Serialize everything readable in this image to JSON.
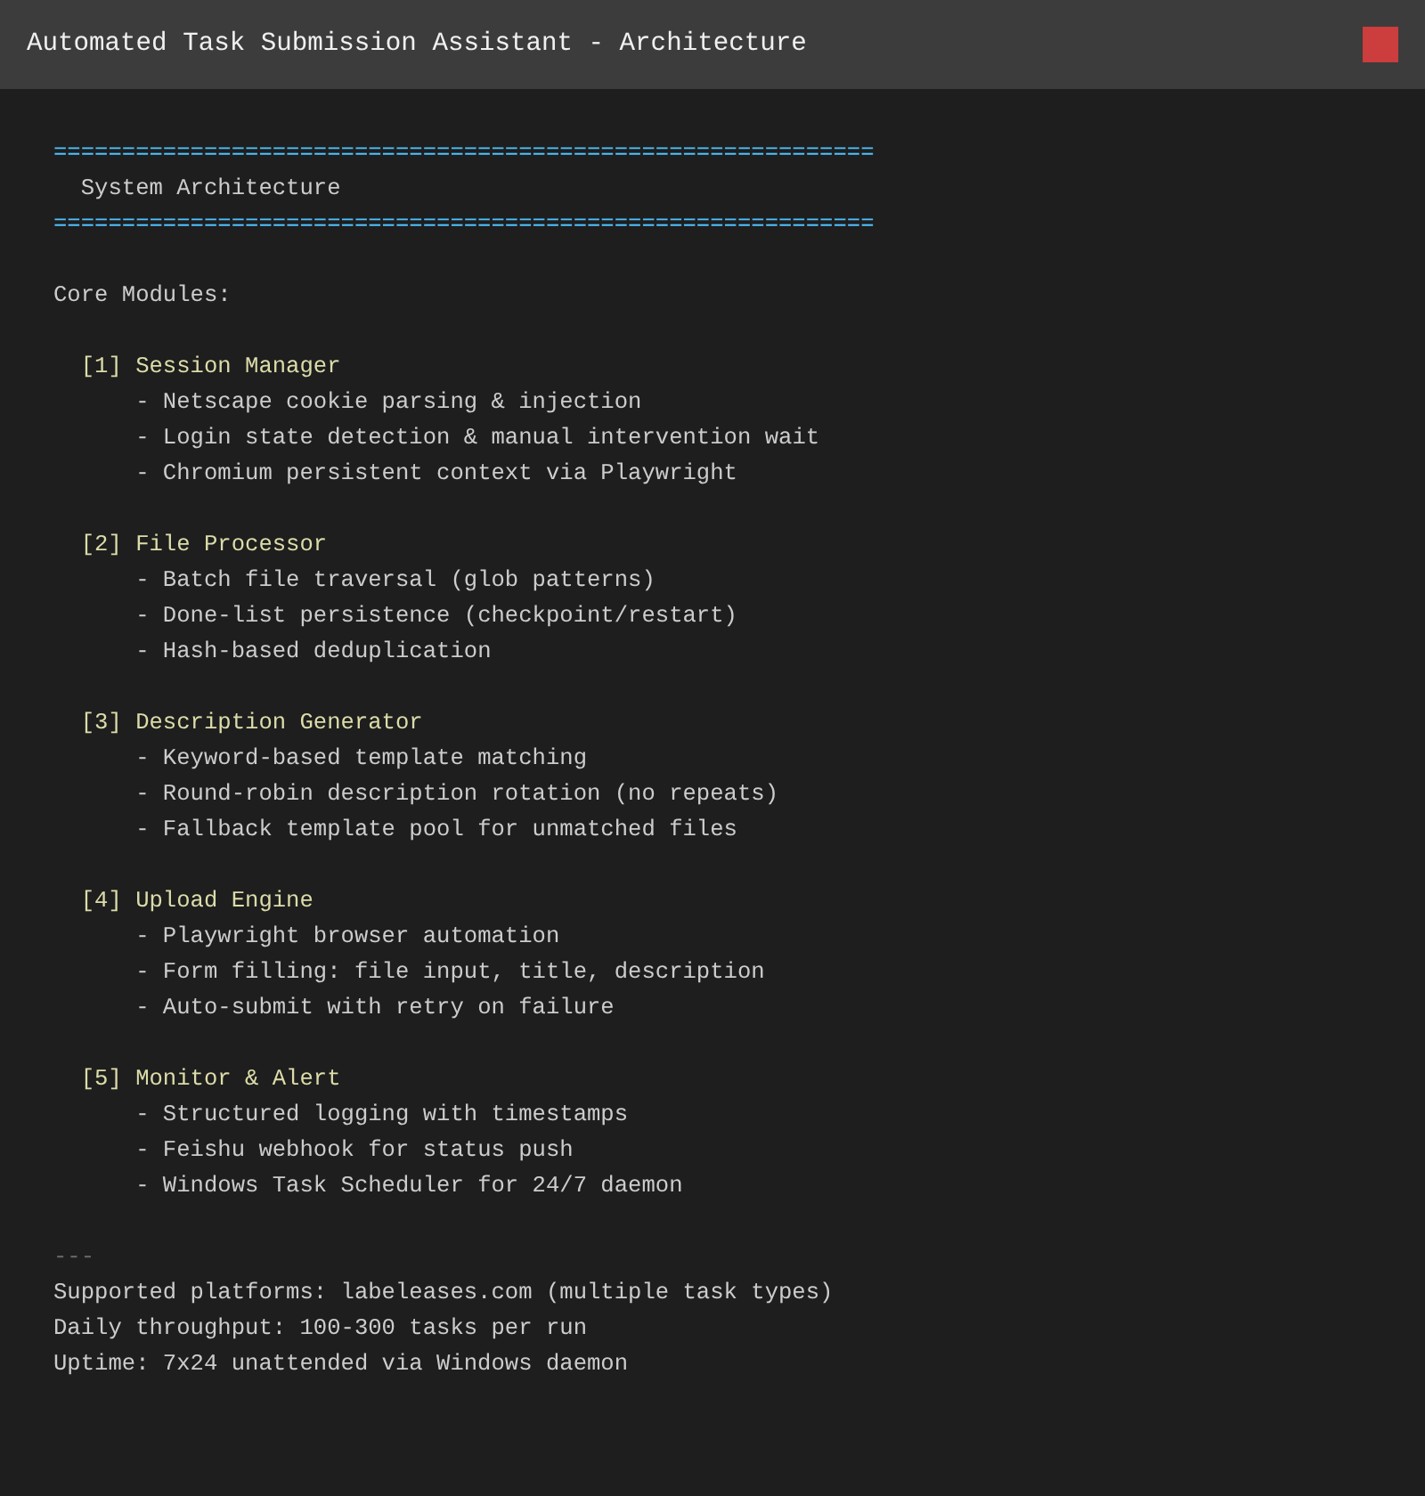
{
  "window": {
    "title": "Automated Task Submission Assistant - Architecture"
  },
  "banner": {
    "rule_top": "============================================================",
    "title": "System Architecture",
    "rule_bottom": "============================================================"
  },
  "heading": "Core Modules:",
  "modules": [
    {
      "number": "[1]",
      "name": "Session Manager",
      "items": [
        "- Netscape cookie parsing & injection",
        "- Login state detection & manual intervention wait",
        "- Chromium persistent context via Playwright"
      ]
    },
    {
      "number": "[2]",
      "name": "File Processor",
      "items": [
        "- Batch file traversal (glob patterns)",
        "- Done-list persistence (checkpoint/restart)",
        "- Hash-based deduplication"
      ]
    },
    {
      "number": "[3]",
      "name": "Description Generator",
      "items": [
        "- Keyword-based template matching",
        "- Round-robin description rotation (no repeats)",
        "- Fallback template pool for unmatched files"
      ]
    },
    {
      "number": "[4]",
      "name": "Upload Engine",
      "items": [
        "- Playwright browser automation",
        "- Form filling: file input, title, description",
        "- Auto-submit with retry on failure"
      ]
    },
    {
      "number": "[5]",
      "name": "Monitor & Alert",
      "items": [
        "- Structured logging with timestamps",
        "- Feishu webhook for status push",
        "- Windows Task Scheduler for 24/7 daemon"
      ]
    }
  ],
  "separator": "---",
  "footer": [
    "Supported platforms: labeleases.com (multiple task types)",
    "Daily throughput: 100-300 tasks per run",
    "Uptime: 7x24 unattended via Windows daemon"
  ]
}
